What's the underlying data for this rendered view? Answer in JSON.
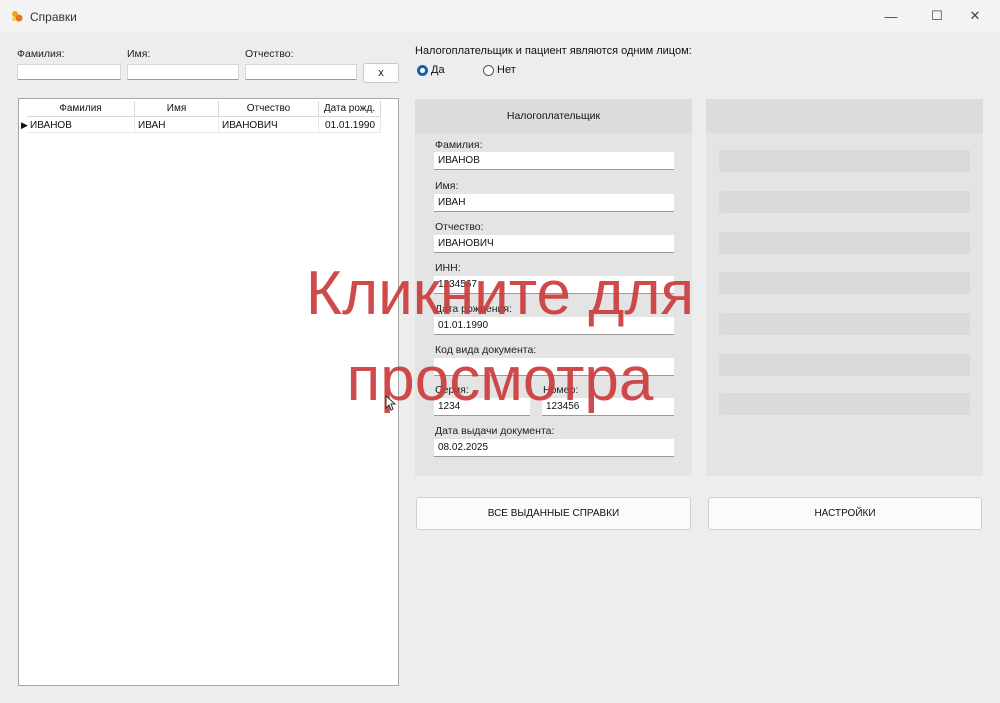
{
  "window": {
    "title": "Справки",
    "controls": [
      "minimize-icon",
      "maximize-icon",
      "close-icon"
    ]
  },
  "search": {
    "lastname_label": "Фамилия:",
    "firstname_label": "Имя:",
    "patronymic_label": "Отчество:",
    "lastname_value": "",
    "firstname_value": "",
    "patronymic_value": "",
    "clear_label": "x"
  },
  "same_person": {
    "question": "Налогоплательщик и пациент являются одним лицом:",
    "yes": "Да",
    "no": "Нет",
    "selected": "Да"
  },
  "grid": {
    "columns": [
      "Фамилия",
      "Имя",
      "Отчество",
      "Дата рожд."
    ],
    "rows": [
      {
        "lastname": "ИВАНОВ",
        "firstname": "ИВАН",
        "patronymic": "ИВАНОВИЧ",
        "birthdate": "01.01.1990"
      }
    ]
  },
  "taxpayer": {
    "header": "Налогоплательщик",
    "lastname_label": "Фамилия:",
    "lastname": "ИВАНОВ",
    "firstname_label": "Имя:",
    "firstname": "ИВАН",
    "patronymic_label": "Отчество:",
    "patronymic": "ИВАНОВИЧ",
    "inn_label": "ИНН:",
    "inn": "1234567",
    "birthdate_label": "Дата рождения:",
    "birthdate": "01.01.1990",
    "doc_code_label": "Код вида документа:",
    "doc_code": "",
    "series_label": "Серия:",
    "series": "1234",
    "number_label": "Номер:",
    "number": "123456",
    "issue_date_label": "Дата выдачи документа:",
    "issue_date": "08.02.2025"
  },
  "buttons": {
    "all_certificates": "ВСЕ ВЫДАННЫЕ СПРАВКИ",
    "settings": "НАСТРОЙКИ"
  },
  "overlay": {
    "line1": "Кликните для",
    "line2": "просмотра"
  },
  "colors": {
    "overlay": "#cc3c3c",
    "radio_accent": "#1a5fb4"
  }
}
